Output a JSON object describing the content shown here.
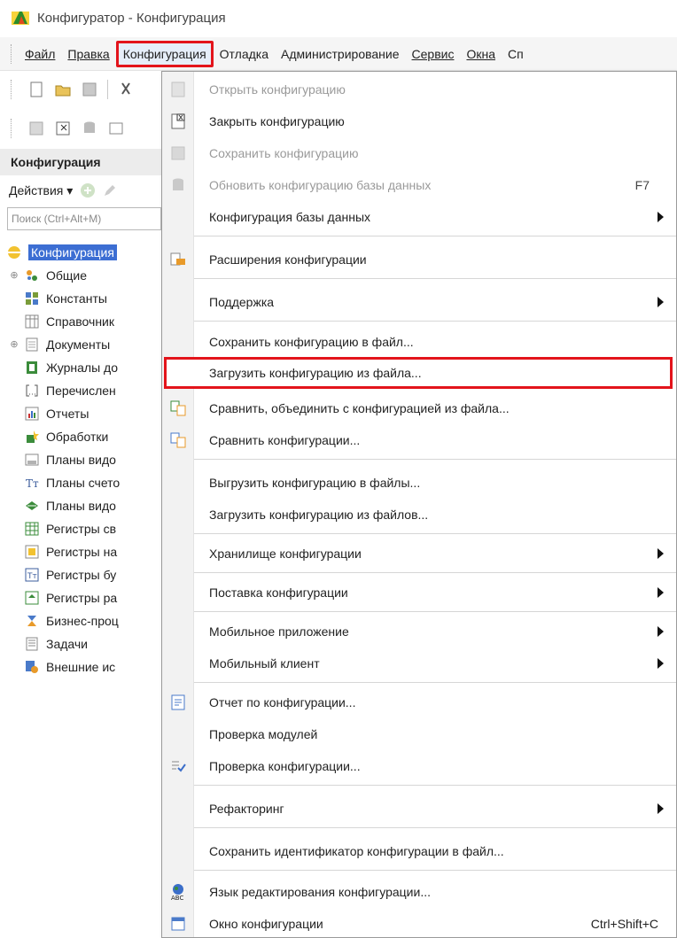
{
  "window": {
    "title": "Конфигуратор - Конфигурация"
  },
  "menubar": {
    "items": [
      {
        "label": "Файл"
      },
      {
        "label": "Правка"
      },
      {
        "label": "Конфигурация"
      },
      {
        "label": "Отладка"
      },
      {
        "label": "Администрирование"
      },
      {
        "label": "Сервис"
      },
      {
        "label": "Окна"
      },
      {
        "label": "Сп"
      }
    ]
  },
  "panel": {
    "title": "Конфигурация",
    "actions_label": "Действия",
    "search_placeholder": "Поиск (Ctrl+Alt+M)"
  },
  "tree": {
    "items": [
      {
        "label": "Конфигурация"
      },
      {
        "label": "Общие"
      },
      {
        "label": "Константы"
      },
      {
        "label": "Справочник"
      },
      {
        "label": "Документы"
      },
      {
        "label": "Журналы до"
      },
      {
        "label": "Перечислен"
      },
      {
        "label": "Отчеты"
      },
      {
        "label": "Обработки"
      },
      {
        "label": "Планы видо"
      },
      {
        "label": "Планы счето"
      },
      {
        "label": "Планы видо"
      },
      {
        "label": "Регистры св"
      },
      {
        "label": "Регистры на"
      },
      {
        "label": "Регистры бу"
      },
      {
        "label": "Регистры ра"
      },
      {
        "label": "Бизнес-проц"
      },
      {
        "label": "Задачи"
      },
      {
        "label": "Внешние ис"
      }
    ]
  },
  "dropdown": {
    "items": [
      {
        "label": "Открыть конфигурацию"
      },
      {
        "label": "Закрыть конфигурацию"
      },
      {
        "label": "Сохранить конфигурацию"
      },
      {
        "label": "Обновить конфигурацию базы данных",
        "shortcut": "F7"
      },
      {
        "label": "Конфигурация базы данных"
      },
      {
        "label": "Расширения конфигурации"
      },
      {
        "label": "Поддержка"
      },
      {
        "label": "Сохранить конфигурацию в файл..."
      },
      {
        "label": "Загрузить конфигурацию из файла..."
      },
      {
        "label": "Сравнить, объединить с конфигурацией из файла..."
      },
      {
        "label": "Сравнить конфигурации..."
      },
      {
        "label": "Выгрузить конфигурацию в файлы..."
      },
      {
        "label": "Загрузить конфигурацию из файлов..."
      },
      {
        "label": "Хранилище конфигурации"
      },
      {
        "label": "Поставка конфигурации"
      },
      {
        "label": "Мобильное приложение"
      },
      {
        "label": "Мобильный клиент"
      },
      {
        "label": "Отчет по конфигурации..."
      },
      {
        "label": "Проверка модулей"
      },
      {
        "label": "Проверка конфигурации..."
      },
      {
        "label": "Рефакторинг"
      },
      {
        "label": "Сохранить идентификатор конфигурации в файл..."
      },
      {
        "label": "Язык редактирования конфигурации..."
      },
      {
        "label": "Окно конфигурации",
        "shortcut": "Ctrl+Shift+C"
      }
    ]
  },
  "colors": {
    "highlight_border": "#e3141b",
    "selection": "#3c6ed3"
  }
}
